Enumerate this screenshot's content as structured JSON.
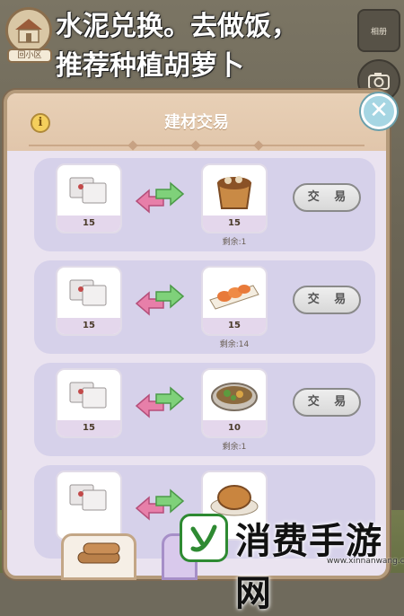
{
  "caption": {
    "line1": "水泥兑换。去做饭，",
    "line2": "推荐种植胡萝卜"
  },
  "hud": {
    "house_label": "回小区",
    "top_right_label": "相册"
  },
  "panel": {
    "title": "建材交易",
    "info_glyph": "i",
    "close_glyph": "✕"
  },
  "trades": [
    {
      "give_count": "15",
      "get_count": "15",
      "remaining": "剩余:1",
      "button": "交 易",
      "give_item": "cement-bag",
      "get_item": "mushroom-pie"
    },
    {
      "give_count": "15",
      "get_count": "15",
      "remaining": "剩余:14",
      "button": "交 易",
      "give_item": "cement-bag",
      "get_item": "fried-dumplings"
    },
    {
      "give_count": "15",
      "get_count": "10",
      "remaining": "剩余:1",
      "button": "交 易",
      "give_item": "cement-bag",
      "get_item": "vegetable-stew"
    },
    {
      "give_count": "",
      "get_count": "",
      "remaining": "",
      "button": "",
      "give_item": "cement-bag",
      "get_item": "roast-chicken"
    }
  ],
  "watermark": {
    "text": "消费手游网",
    "url": "www.xinnanwang.com"
  },
  "colors": {
    "panel_bg": "#eae3f0",
    "row_bg": "#d6d1ea",
    "header_bg": "#e1c6ab",
    "arrow_pink": "#e77fa9",
    "arrow_green": "#7fd17a",
    "close_btn": "#a6d6e3"
  }
}
